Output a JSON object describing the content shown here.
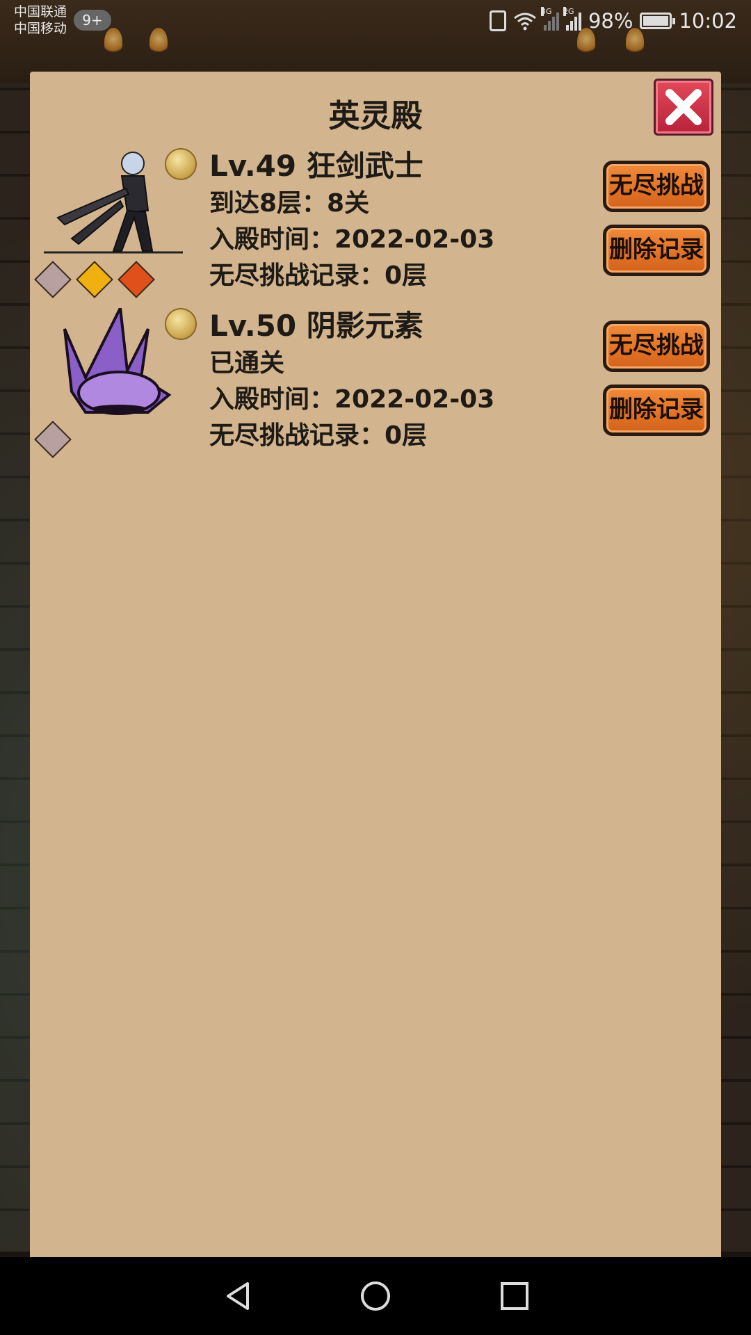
{
  "status_bar": {
    "carrier_1": "中国联通",
    "carrier_2": "中国移动",
    "notification_count": "9+",
    "net_3g": "3G",
    "net_2g": "2G",
    "battery": "98%",
    "battery_level": 0.98,
    "time": "10:02"
  },
  "panel": {
    "title": "英灵殿"
  },
  "records": [
    {
      "name": "Lv.49 狂剑武士",
      "progress": "到达8层：8关",
      "date": "入殿时间：2022-02-03",
      "endless": "无尽挑战记录：0层",
      "endless_button": "无尽挑战",
      "delete_button": "删除记录",
      "gems": [
        "silver",
        "gold",
        "red"
      ]
    },
    {
      "name": "Lv.50 阴影元素",
      "progress": "已通关",
      "date": "入殿时间：2022-02-03",
      "endless": "无尽挑战记录：0层",
      "endless_button": "无尽挑战",
      "delete_button": "删除记录",
      "gems": [
        "silver"
      ]
    }
  ],
  "colors": {
    "panel_bg": "#d2b48e",
    "button_orange": "#e2762a",
    "close_red": "#c9304a",
    "gem_silver": "#b8a0a0",
    "gem_gold": "#f0b010",
    "gem_red": "#e0501a"
  },
  "icons": {
    "close": "close-icon",
    "magnifier": "magnifier-icon",
    "nav_back": "back-triangle-icon",
    "nav_home": "home-circle-icon",
    "nav_recent": "recent-square-icon"
  }
}
